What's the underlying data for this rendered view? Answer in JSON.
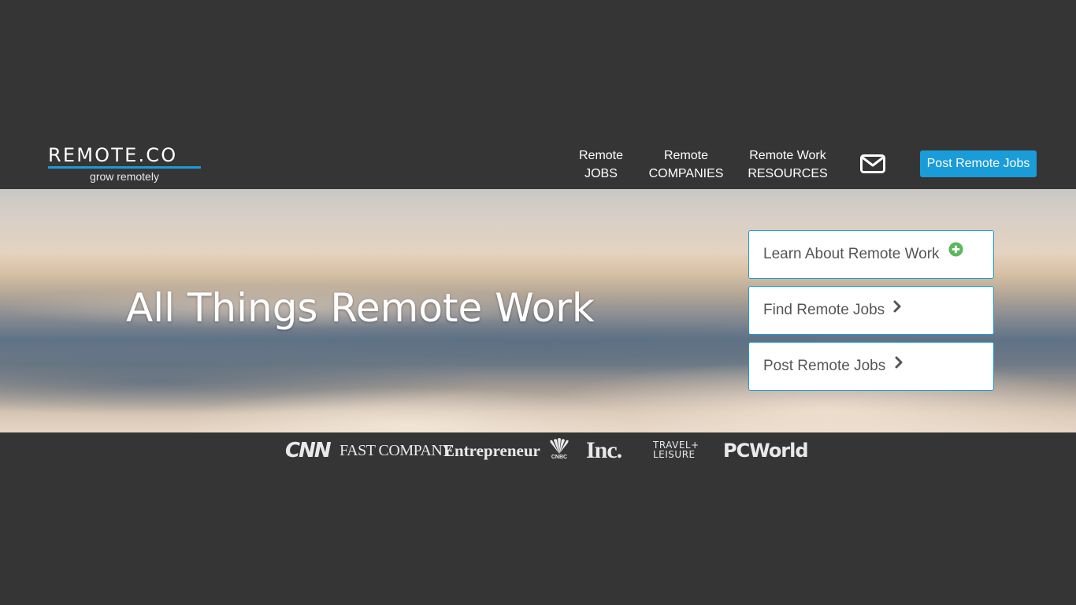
{
  "header": {
    "logo": {
      "name": "REMOTE.CO",
      "tagline": "grow remotely"
    },
    "nav": [
      {
        "line1": "Remote",
        "line2": "JOBS"
      },
      {
        "line1": "Remote",
        "line2": "COMPANIES"
      },
      {
        "line1": "Remote Work",
        "line2": "RESOURCES"
      }
    ],
    "mail_icon": "envelope-icon",
    "post_button": "Post Remote Jobs"
  },
  "hero": {
    "title": "All Things Remote Work",
    "cards": [
      {
        "label": "Learn About Remote Work",
        "icon": "plus-circle-icon"
      },
      {
        "label": "Find Remote Jobs",
        "icon": "chevron-right-icon"
      },
      {
        "label": "Post Remote Jobs",
        "icon": "chevron-right-icon"
      }
    ]
  },
  "press": {
    "logos": [
      "CNN",
      "FASTCOMPANY",
      "Entrepreneur",
      "CNBC",
      "Inc.",
      "TRAVEL+ LEISURE",
      "PCWorld"
    ],
    "cnn": "CNN",
    "fast_company": "FAST COMPANY",
    "entrepreneur": "Entrepreneur",
    "cnbc": "CNBC",
    "inc": "Inc.",
    "travel_line1": "TRAVEL+",
    "travel_line2": "LEISURE",
    "pcworld": "PCWorld"
  },
  "colors": {
    "background": "#353535",
    "accent": "#1a9cd8",
    "plus_icon": "#5cb85c",
    "card_text": "#555555"
  }
}
